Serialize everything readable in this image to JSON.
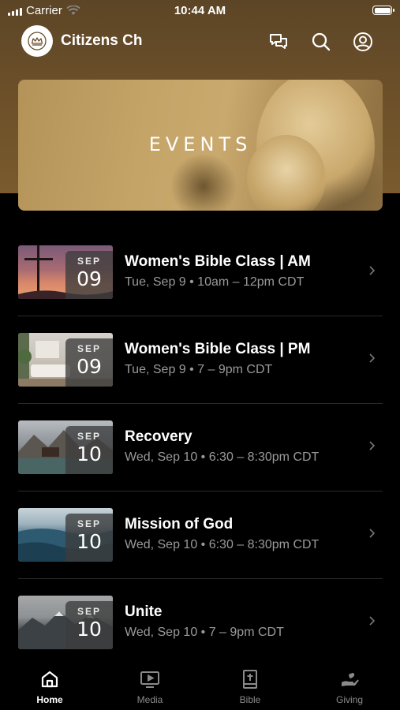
{
  "status_bar": {
    "carrier": "Carrier",
    "time": "10:44 AM"
  },
  "app_bar": {
    "title": "Citizens Ch"
  },
  "banner": {
    "title": "EVENTS"
  },
  "events": [
    {
      "month": "SEP",
      "day": "09",
      "title": "Women's Bible Class | AM",
      "subtitle": "Tue, Sep 9 • 10am – 12pm CDT"
    },
    {
      "month": "SEP",
      "day": "09",
      "title": "Women's Bible Class | PM",
      "subtitle": "Tue, Sep 9 • 7 – 9pm CDT"
    },
    {
      "month": "SEP",
      "day": "10",
      "title": "Recovery",
      "subtitle": "Wed, Sep 10 • 6:30 – 8:30pm CDT"
    },
    {
      "month": "SEP",
      "day": "10",
      "title": "Mission of God",
      "subtitle": "Wed, Sep 10 • 6:30 – 8:30pm CDT"
    },
    {
      "month": "SEP",
      "day": "10",
      "title": "Unite",
      "subtitle": "Wed, Sep 10 • 7 – 9pm CDT"
    }
  ],
  "tabs": [
    {
      "label": "Home",
      "icon": "home-icon",
      "active": true
    },
    {
      "label": "Media",
      "icon": "media-icon",
      "active": false
    },
    {
      "label": "Bible",
      "icon": "bible-icon",
      "active": false
    },
    {
      "label": "Giving",
      "icon": "giving-icon",
      "active": false
    }
  ],
  "colors": {
    "header": "#6b4f29",
    "background": "#000000",
    "subtitle": "#9a9a9a"
  }
}
